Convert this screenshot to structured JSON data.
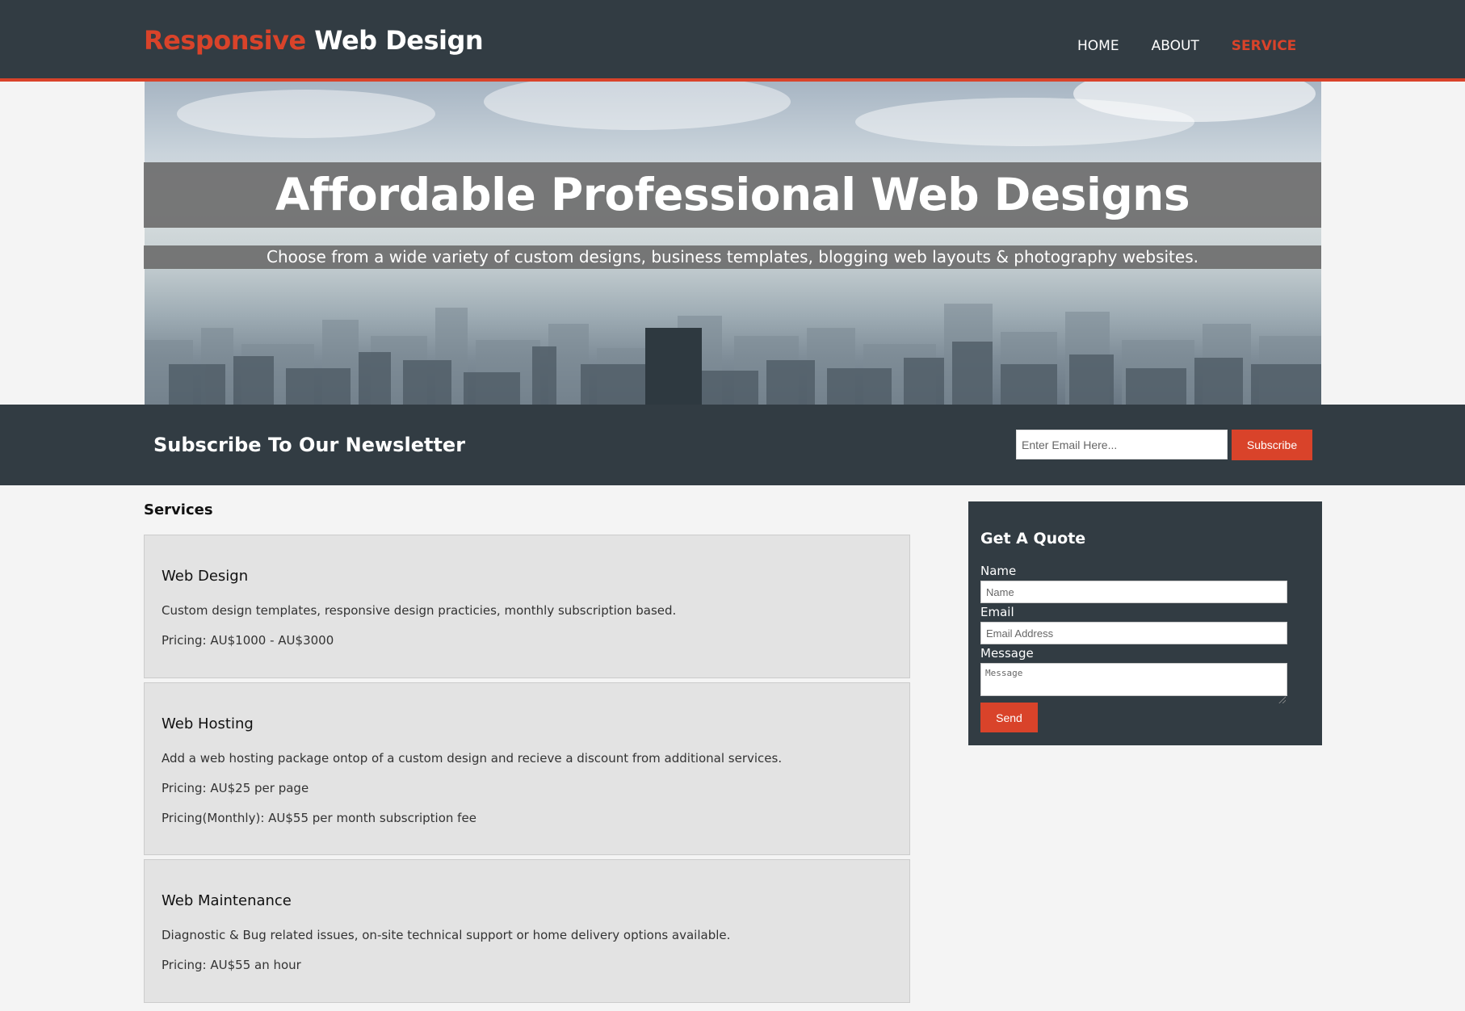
{
  "header": {
    "brand_accent": "Responsive",
    "brand_rest": "Web Design",
    "nav": [
      {
        "label": "HOME",
        "active": false
      },
      {
        "label": "ABOUT",
        "active": false
      },
      {
        "label": "SERVICE",
        "active": true
      }
    ]
  },
  "hero": {
    "title": "Affordable Professional Web Designs",
    "subtitle": "Choose from a wide variety of custom designs, business templates, blogging web layouts & photography websites."
  },
  "newsletter": {
    "title": "Subscribe To Our Newsletter",
    "email_placeholder": "Enter Email Here...",
    "button_label": "Subscribe"
  },
  "services": {
    "heading": "Services",
    "items": [
      {
        "title": "Web Design",
        "lines": [
          "Custom design templates, responsive design practicies, monthly subscription based.",
          "Pricing: AU$1000 - AU$3000"
        ]
      },
      {
        "title": "Web Hosting",
        "lines": [
          "Add a web hosting package ontop of a custom design and recieve a discount from additional services.",
          "Pricing: AU$25 per page",
          "Pricing(Monthly): AU$55 per month subscription fee"
        ]
      },
      {
        "title": "Web Maintenance",
        "lines": [
          "Diagnostic & Bug related issues, on-site technical support or home delivery options available.",
          "Pricing: AU$55 an hour"
        ]
      }
    ]
  },
  "quote": {
    "title": "Get A Quote",
    "name_label": "Name",
    "name_placeholder": "Name",
    "email_label": "Email",
    "email_placeholder": "Email Address",
    "message_label": "Message",
    "message_placeholder": "Message",
    "send_label": "Send"
  },
  "colors": {
    "accent": "#d9432a",
    "dark": "#323c43",
    "card": "#e3e3e3",
    "page": "#f4f4f4"
  }
}
